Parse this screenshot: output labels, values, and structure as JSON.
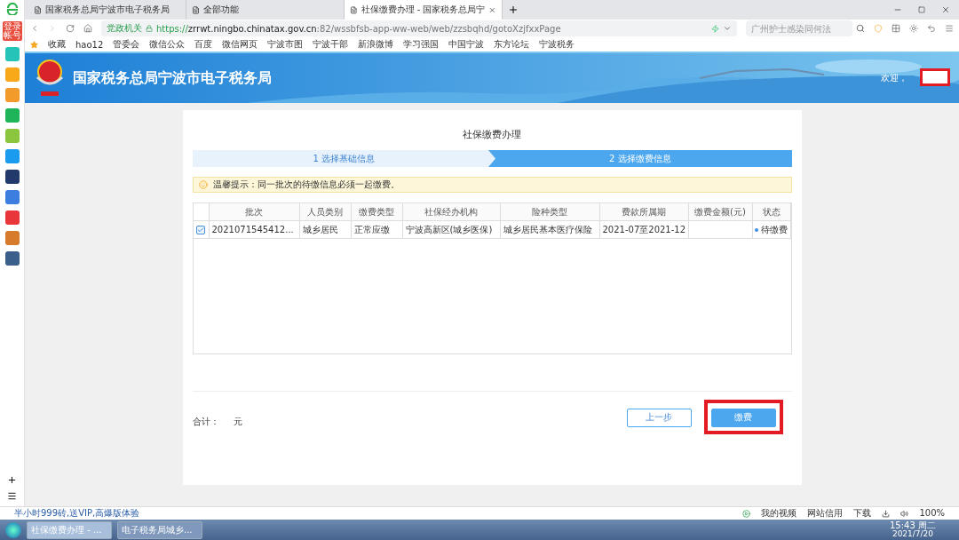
{
  "browser": {
    "tabs": [
      {
        "title": "国家税务总局宁波市电子税务局",
        "selected": false
      },
      {
        "title": "全部功能",
        "selected": false
      },
      {
        "title": "社保缴费办理 - 国家税务总局宁",
        "selected": true
      }
    ],
    "security_label": "党政机关",
    "url_scheme": "https://",
    "url_host": "zrrwt.ningbo.chinatax.gov.cn",
    "url_path": ":82/wssbfsb-app-ww-web/web/zzsbqhd/gotoXzjfxxPage",
    "search": {
      "placeholder": "广州护士感染同何法"
    },
    "bookmarks": [
      "收藏",
      "hao12",
      "管委会",
      "微信公众",
      "百度",
      "微信网页",
      "宁波市图",
      "宁波干部",
      "新浪微博",
      "学习强国",
      "中国宁波",
      "东方论坛",
      "宁波税务"
    ],
    "account_label": "登录帐号"
  },
  "site": {
    "title": "国家税务总局宁波市电子税务局",
    "welcome": "欢迎，"
  },
  "card": {
    "title": "社保缴费办理",
    "steps": [
      {
        "label": "1 选择基础信息",
        "selected": false
      },
      {
        "label": "2 选择缴费信息",
        "selected": true
      }
    ],
    "notice": "温馨提示：同一批次的待缴信息必须一起缴费。",
    "columns": [
      "批次",
      "人员类别",
      "缴费类型",
      "社保经办机构",
      "险种类型",
      "费款所属期",
      "缴费金额(元)",
      "状态"
    ],
    "rows": [
      {
        "checked": true,
        "cells": [
          "2021071545412...",
          "城乡居民",
          "正常应缴",
          "宁波高新区(城乡医保)",
          "城乡居民基本医疗保险",
          "2021-07至2021-12",
          ""
        ],
        "status": "待缴费",
        "color": "#3c8ee8"
      }
    ],
    "total_label": "合计：",
    "total_unit": "元",
    "buttons": [
      {
        "label": "上一步",
        "kind": "secondary",
        "highlighted": false
      },
      {
        "label": "缴费",
        "kind": "primary",
        "highlighted": true
      }
    ]
  },
  "status_bar": {
    "promo": "半小时999砖,送VIP,高爆版体验",
    "items": [
      "我的视频",
      "网站信用",
      "下载"
    ],
    "zoom": "100%"
  },
  "taskbar": {
    "tasks": [
      {
        "title": "社保缴费办理 - ...",
        "selected": true
      },
      {
        "title": "电子税务局城乡...",
        "selected": false
      }
    ],
    "time": "15:43 周二",
    "date": "2021/7/20"
  }
}
